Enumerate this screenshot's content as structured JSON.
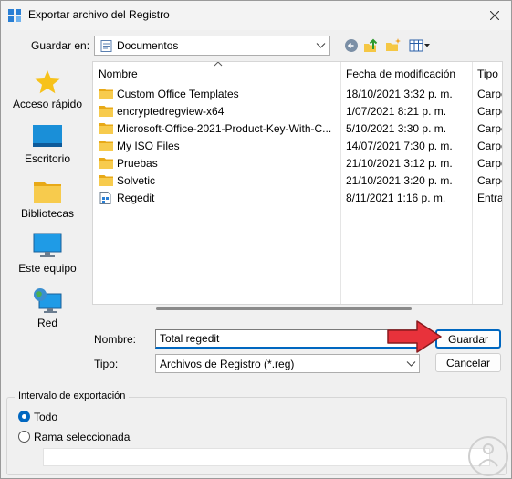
{
  "window": {
    "title": "Exportar archivo del Registro"
  },
  "toolbar": {
    "save_in_label": "Guardar en:",
    "location": "Documentos"
  },
  "places": [
    {
      "label": "Acceso rápido",
      "icon": "star-icon"
    },
    {
      "label": "Escritorio",
      "icon": "desktop-icon"
    },
    {
      "label": "Bibliotecas",
      "icon": "libraries-icon"
    },
    {
      "label": "Este equipo",
      "icon": "computer-icon"
    },
    {
      "label": "Red",
      "icon": "network-icon"
    }
  ],
  "filelist": {
    "columns": [
      "Nombre",
      "Fecha de modificación",
      "Tipo"
    ],
    "rows": [
      {
        "name": "Custom Office Templates",
        "date": "18/10/2021 3:32 p. m.",
        "type": "Carpe",
        "icon": "folder-icon"
      },
      {
        "name": "encryptedregview-x64",
        "date": "1/07/2021 8:21 p. m.",
        "type": "Carpe",
        "icon": "folder-icon"
      },
      {
        "name": "Microsoft-Office-2021-Product-Key-With-C...",
        "date": "5/10/2021 3:30 p. m.",
        "type": "Carpe",
        "icon": "folder-icon"
      },
      {
        "name": "My ISO Files",
        "date": "14/07/2021 7:30 p. m.",
        "type": "Carpe",
        "icon": "folder-icon"
      },
      {
        "name": "Pruebas",
        "date": "21/10/2021 3:12 p. m.",
        "type": "Carpe",
        "icon": "folder-icon"
      },
      {
        "name": "Solvetic",
        "date": "21/10/2021 3:20 p. m.",
        "type": "Carpe",
        "icon": "folder-icon"
      },
      {
        "name": "Regedit",
        "date": "8/11/2021 1:16 p. m.",
        "type": "Entra",
        "icon": "registry-file-icon"
      }
    ]
  },
  "form": {
    "name_label": "Nombre:",
    "name_value": "Total regedit",
    "type_label": "Tipo:",
    "type_value": "Archivos de Registro (*.reg)",
    "save_button": "Guardar",
    "cancel_button": "Cancelar"
  },
  "export_range": {
    "title": "Intervalo de exportación",
    "option_all": "Todo",
    "option_branch": "Rama seleccionada",
    "selected": "Todo",
    "branch_value": ""
  },
  "colors": {
    "accent": "#0067c0",
    "folder": "#f5c744",
    "arrow": "#e8323b"
  }
}
